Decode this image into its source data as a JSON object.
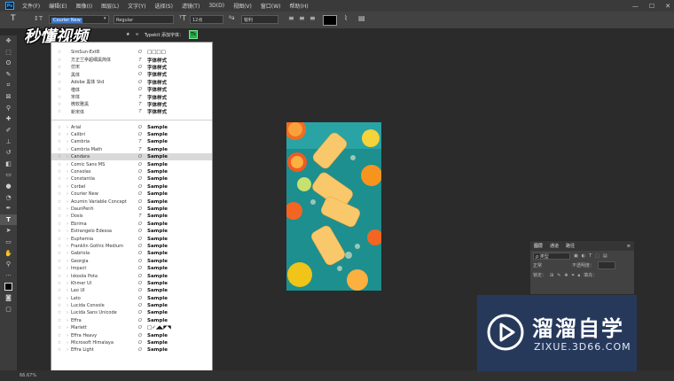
{
  "menubar": {
    "app_icon": "Ps",
    "items": [
      "文件(F)",
      "编辑(E)",
      "图像(I)",
      "图层(L)",
      "文字(Y)",
      "选择(S)",
      "滤镜(T)",
      "3D(D)",
      "视图(V)",
      "窗口(W)",
      "帮助(H)"
    ]
  },
  "options": {
    "font_family": "Courier New",
    "font_style": "Regular",
    "font_size": "12点",
    "antialias": "锐利"
  },
  "watermark_top": "秒懂视频",
  "typekit": {
    "star": "★",
    "approx": "≈",
    "label": "Typekit 添加字体：",
    "tk": "Tk"
  },
  "font_list": {
    "favorites": [
      {
        "name": "SimSun-ExtB",
        "type": "O",
        "sample": "□□□□"
      },
      {
        "name": "方正兰亭超细黑简体",
        "type": "T",
        "sample": "字体样式"
      },
      {
        "name": "仿宋",
        "type": "O",
        "sample": "字体样式"
      },
      {
        "name": "黑体",
        "type": "O",
        "sample": "字体样式"
      },
      {
        "name": "Adobe 黑体 Std",
        "type": "O",
        "sample": "字体样式"
      },
      {
        "name": "楷体",
        "type": "O",
        "sample": "字体样式"
      },
      {
        "name": "宋体",
        "type": "T",
        "sample": "字体样式"
      },
      {
        "name": "微软雅黑",
        "type": "T",
        "sample": "字体样式"
      },
      {
        "name": "新宋体",
        "type": "T",
        "sample": "字体样式"
      }
    ],
    "fonts": [
      {
        "name": "Arial",
        "type": "O",
        "sample": "Sample"
      },
      {
        "name": "Calibri",
        "type": "O",
        "sample": "Sample"
      },
      {
        "name": "Cambria",
        "type": "T",
        "sample": "Sample"
      },
      {
        "name": "Cambria Math",
        "type": "T",
        "sample": "Sample"
      },
      {
        "name": "Candara",
        "type": "O",
        "sample": "Sample"
      },
      {
        "name": "Comic Sans MS",
        "type": "O",
        "sample": "Sample"
      },
      {
        "name": "Consolas",
        "type": "O",
        "sample": "Sample"
      },
      {
        "name": "Constantia",
        "type": "O",
        "sample": "Sample"
      },
      {
        "name": "Corbel",
        "type": "O",
        "sample": "Sample"
      },
      {
        "name": "Courier New",
        "type": "O",
        "sample": "Sample"
      },
      {
        "name": "Acumin Variable Concept",
        "type": "O",
        "sample": "Sample"
      },
      {
        "name": "DaunPenh",
        "type": "O",
        "sample": "Sample"
      },
      {
        "name": "Dosis",
        "type": "T",
        "sample": "Sample"
      },
      {
        "name": "Ebrima",
        "type": "O",
        "sample": "Sample"
      },
      {
        "name": "Estrangelo Edessa",
        "type": "O",
        "sample": "Sample"
      },
      {
        "name": "Euphemia",
        "type": "O",
        "sample": "Sample"
      },
      {
        "name": "Franklin Gothic Medium",
        "type": "O",
        "sample": "Sample"
      },
      {
        "name": "Gabriola",
        "type": "O",
        "sample": "Sample"
      },
      {
        "name": "Georgia",
        "type": "O",
        "sample": "Sample"
      },
      {
        "name": "Impact",
        "type": "O",
        "sample": "Sample"
      },
      {
        "name": "Iskoola Pota",
        "type": "O",
        "sample": "Sample"
      },
      {
        "name": "Khmer UI",
        "type": "O",
        "sample": "Sample"
      },
      {
        "name": "Lao UI",
        "type": "O",
        "sample": "Sample"
      },
      {
        "name": "Lato",
        "type": "O",
        "sample": "Sample"
      },
      {
        "name": "Lucida Console",
        "type": "O",
        "sample": "Sample"
      },
      {
        "name": "Lucida Sans Unicode",
        "type": "O",
        "sample": "Sample"
      },
      {
        "name": "Effra",
        "type": "O",
        "sample": "Sample"
      },
      {
        "name": "Marlett",
        "type": "O",
        "sample": "□✓◢◣◤◥"
      },
      {
        "name": "Effra Heavy",
        "type": "O",
        "sample": "Sample"
      },
      {
        "name": "Microsoft Himalaya",
        "type": "O",
        "sample": "Sample"
      },
      {
        "name": "Effra Light",
        "type": "O",
        "sample": "Sample"
      }
    ]
  },
  "layers_panel": {
    "tabs": [
      "图层",
      "通道",
      "路径"
    ],
    "kind": "ρ 类型",
    "blend": "正常",
    "opacity": "不透明度：",
    "lock": "锁定：",
    "fill": "填充："
  },
  "statusbar": {
    "zoom": "66.67%"
  },
  "watermark_br": {
    "title": "溜溜自学",
    "url": "ZIXUE.3D66.COM"
  },
  "colors": {
    "accent": "#3f79c9",
    "panel": "#424242",
    "bg": "#2b2b2b",
    "fontlist_bg": "#ffffff"
  }
}
